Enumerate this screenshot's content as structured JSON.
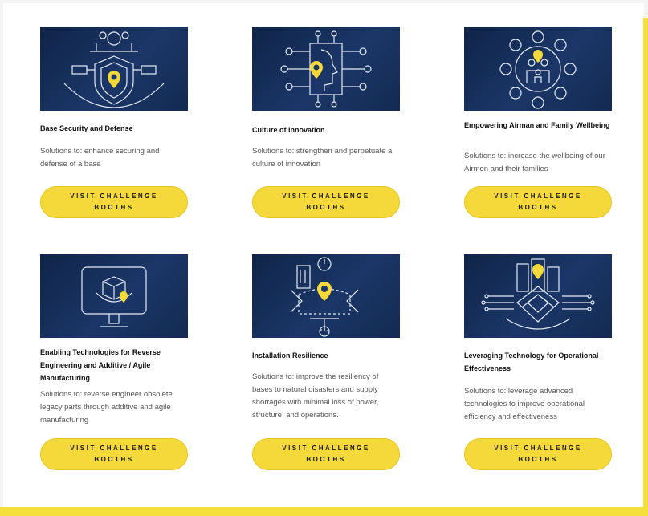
{
  "colors": {
    "accent": "#f5d93a",
    "thumb_bg": "#1b3668",
    "line_art": "#e6ecf5",
    "pin": "#f5d93a"
  },
  "cards": [
    {
      "title": "Base Security and Defense",
      "description": "Solutions to: enhance securing and defense of a base",
      "button": "VISIT CHALLENGE BOOTHS",
      "icon": "shield-security-icon"
    },
    {
      "title": "Culture of Innovation",
      "description": "Solutions to: strengthen and perpetuate a culture of innovation",
      "button": "VISIT CHALLENGE BOOTHS",
      "icon": "innovation-head-icon"
    },
    {
      "title": "Empowering Airman and Family Wellbeing",
      "description": "Solutions to: increase the wellbeing of our Airmen and their families",
      "button": "VISIT CHALLENGE BOOTHS",
      "icon": "family-wellbeing-icon"
    },
    {
      "title": "Enabling Technologies for Reverse Engineering and Additive / Agile Manufacturing",
      "description": "Solutions to: reverse engineer obsolete legacy parts through additive and agile manufacturing",
      "button": "VISIT CHALLENGE BOOTHS",
      "icon": "monitor-cube-icon"
    },
    {
      "title": "Installation Resilience",
      "description": "Solutions to: improve the resiliency of bases to natural disasters and supply shortages with minimal loss of power, structure, and operations.",
      "button": "VISIT CHALLENGE BOOTHS",
      "icon": "installation-resilience-icon"
    },
    {
      "title": "Leveraging Technology for Operational Effectiveness",
      "description": "Solutions to: leverage advanced technologies to improve operational efficiency and effectiveness",
      "button": "VISIT CHALLENGE BOOTHS",
      "icon": "city-circuit-icon"
    }
  ]
}
